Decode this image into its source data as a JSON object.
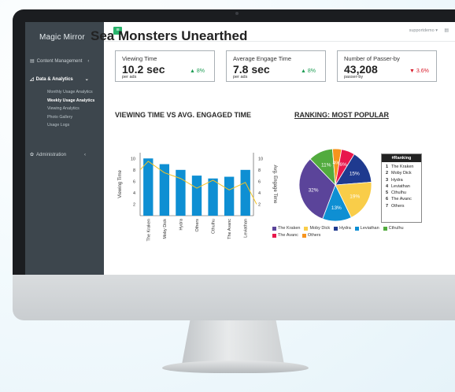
{
  "app": {
    "name": "Magic Mirror"
  },
  "sidebar": {
    "items": [
      {
        "label": "Content Management",
        "icon": "folder-icon"
      },
      {
        "label": "Data & Analytics",
        "icon": "chart-icon"
      },
      {
        "label": "Administration",
        "icon": "gear-icon"
      }
    ],
    "subitems": [
      {
        "label": "Monthly Usage Analytics"
      },
      {
        "label": "Weekly Usage Analytics",
        "active": true
      },
      {
        "label": "Viewing Analytics"
      },
      {
        "label": "Photo Gallery"
      },
      {
        "label": "Usage Logs"
      }
    ]
  },
  "topbar": {
    "user": "supportdemo"
  },
  "page": {
    "title": "Sea Monsters Unearthed"
  },
  "cards": [
    {
      "label": "Viewing Time",
      "value": "10.2 sec",
      "unit": "per ads",
      "delta": "▲ 8%",
      "trend": "up"
    },
    {
      "label": "Average Engage Time",
      "value": "7.8 sec",
      "unit": "per ads",
      "delta": "▲ 8%",
      "trend": "up"
    },
    {
      "label": "Number of Passer-by",
      "value": "43,208",
      "unit": "passer-by",
      "delta": "▼ 3.6%",
      "trend": "down"
    }
  ],
  "sections": {
    "bar_title": "VIEWING TIME VS AVG. ENGAGED TIME",
    "pie_title": "RANKING: MOST POPULAR"
  },
  "chart_data": [
    {
      "type": "bar",
      "categories": [
        "The Kraken",
        "Moby Dick",
        "Hydra",
        "Others",
        "Cthulhu",
        "The Avanc",
        "Leviathan"
      ],
      "series": [
        {
          "name": "Viewing Time",
          "values": [
            10,
            9,
            8,
            7,
            6.5,
            6.8,
            8
          ],
          "color": "#0e8fd3"
        },
        {
          "name": "Avg. Engage Time",
          "values": [
            9.5,
            7.5,
            6.5,
            4.8,
            6.2,
            4.5,
            5.8
          ],
          "color": "#f5c322"
        }
      ],
      "ylabel": "Viewing Time",
      "y2label": "Avg. Engage Time",
      "yticks": [
        "2",
        "4",
        "6",
        "8",
        "10"
      ],
      "ylim": [
        0,
        11
      ]
    },
    {
      "type": "pie",
      "labels": [
        "The Kraken",
        "Moby Dick",
        "Hydra",
        "Leviathan",
        "Cthulhu",
        "The Avanc",
        "Others"
      ],
      "values": [
        32,
        19,
        15,
        13,
        11,
        6,
        4
      ],
      "slice_labels": [
        "32%",
        "19%",
        "15%",
        "13%",
        "11%",
        "6%",
        "4%"
      ],
      "colors": [
        "#5b449a",
        "#f9cd49",
        "#1f3a8f",
        "#0e8fd3",
        "#52ab3e",
        "#e8174c",
        "#f7941d"
      ]
    }
  ],
  "ranking": {
    "title": "#Ranking",
    "items": [
      "The Kraken",
      "Moby Dick",
      "Hydra",
      "Leviathan",
      "Cthulhu",
      "The Avanc",
      "Others"
    ]
  },
  "legend": [
    {
      "label": "The Kraken",
      "color": "#5b449a"
    },
    {
      "label": "Moby Dick",
      "color": "#f9cd49"
    },
    {
      "label": "Hydra",
      "color": "#1f3a8f"
    },
    {
      "label": "Leviathan",
      "color": "#0e8fd3"
    },
    {
      "label": "Cthulhu",
      "color": "#52ab3e"
    },
    {
      "label": "The Avanc",
      "color": "#e8174c"
    },
    {
      "label": "Others",
      "color": "#f7941d"
    }
  ]
}
